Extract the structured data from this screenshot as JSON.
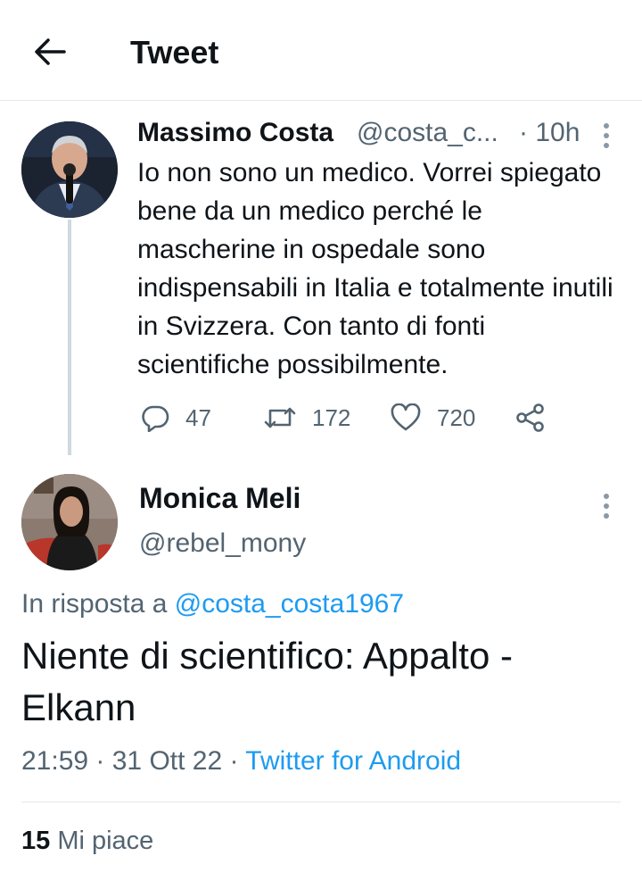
{
  "header": {
    "back_icon": "arrow-left-icon",
    "title": "Tweet"
  },
  "parent_tweet": {
    "name": "Massimo Costa",
    "handle": "@costa_c...",
    "time": "· 10h",
    "text": "Io non sono un medico. Vorrei spiegato bene da un medico perché le mascherine in ospedale sono indispensabili in Italia e totalmente inutili in Svizzera. Con tanto di fonti scientifiche possibilmente.",
    "actions": {
      "replies": "47",
      "retweets": "172",
      "likes": "720"
    }
  },
  "reply_tweet": {
    "name": "Monica Meli",
    "handle": "@rebel_mony",
    "reply_prefix": "In risposta a ",
    "reply_to": "@costa_costa1967",
    "text": "Niente di scientifico: Appalto - Elkann",
    "time": "21:59",
    "sep1": " · ",
    "date": "31 Ott 22",
    "sep2": " · ",
    "source": "Twitter for Android",
    "likes_count": "15",
    "likes_label": "Mi piace"
  },
  "colors": {
    "accent": "#1d9bf0",
    "text": "#0f1419",
    "secondary": "#536471",
    "divider": "#e4e8eb"
  }
}
